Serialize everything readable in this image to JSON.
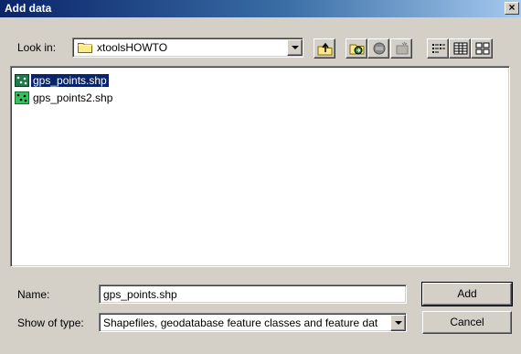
{
  "window": {
    "title": "Add data",
    "close_glyph": "×"
  },
  "look_in": {
    "label": "Look in:",
    "value": "xtoolsHOWTO",
    "icon": "folder-icon"
  },
  "toolbar": {
    "buttons": [
      {
        "name": "up-one-level",
        "icon": "up-folder-icon"
      },
      {
        "name": "connect-to-folder",
        "icon": "connect-folder-icon"
      },
      {
        "name": "disconnect-folder",
        "icon": "disconnect-folder-icon"
      },
      {
        "name": "new-item",
        "icon": "new-item-icon"
      },
      {
        "name": "list-view",
        "icon": "list-view-icon"
      },
      {
        "name": "details-view",
        "icon": "details-view-icon"
      },
      {
        "name": "thumbnails-view",
        "icon": "thumbnails-view-icon"
      }
    ]
  },
  "files": [
    {
      "name": "gps_points.shp",
      "selected": true,
      "icon": "point-shapefile-icon"
    },
    {
      "name": "gps_points2.shp",
      "selected": false,
      "icon": "point-shapefile-icon"
    }
  ],
  "name_field": {
    "label": "Name:",
    "value": "gps_points.shp"
  },
  "type_field": {
    "label": "Show of type:",
    "value": "Shapefiles, geodatabase feature classes and feature dat"
  },
  "buttons": {
    "add": "Add",
    "cancel": "Cancel"
  },
  "colors": {
    "title_start": "#0a246a",
    "title_end": "#a6caf0",
    "face": "#d4d0c8",
    "selection": "#0a246a"
  }
}
